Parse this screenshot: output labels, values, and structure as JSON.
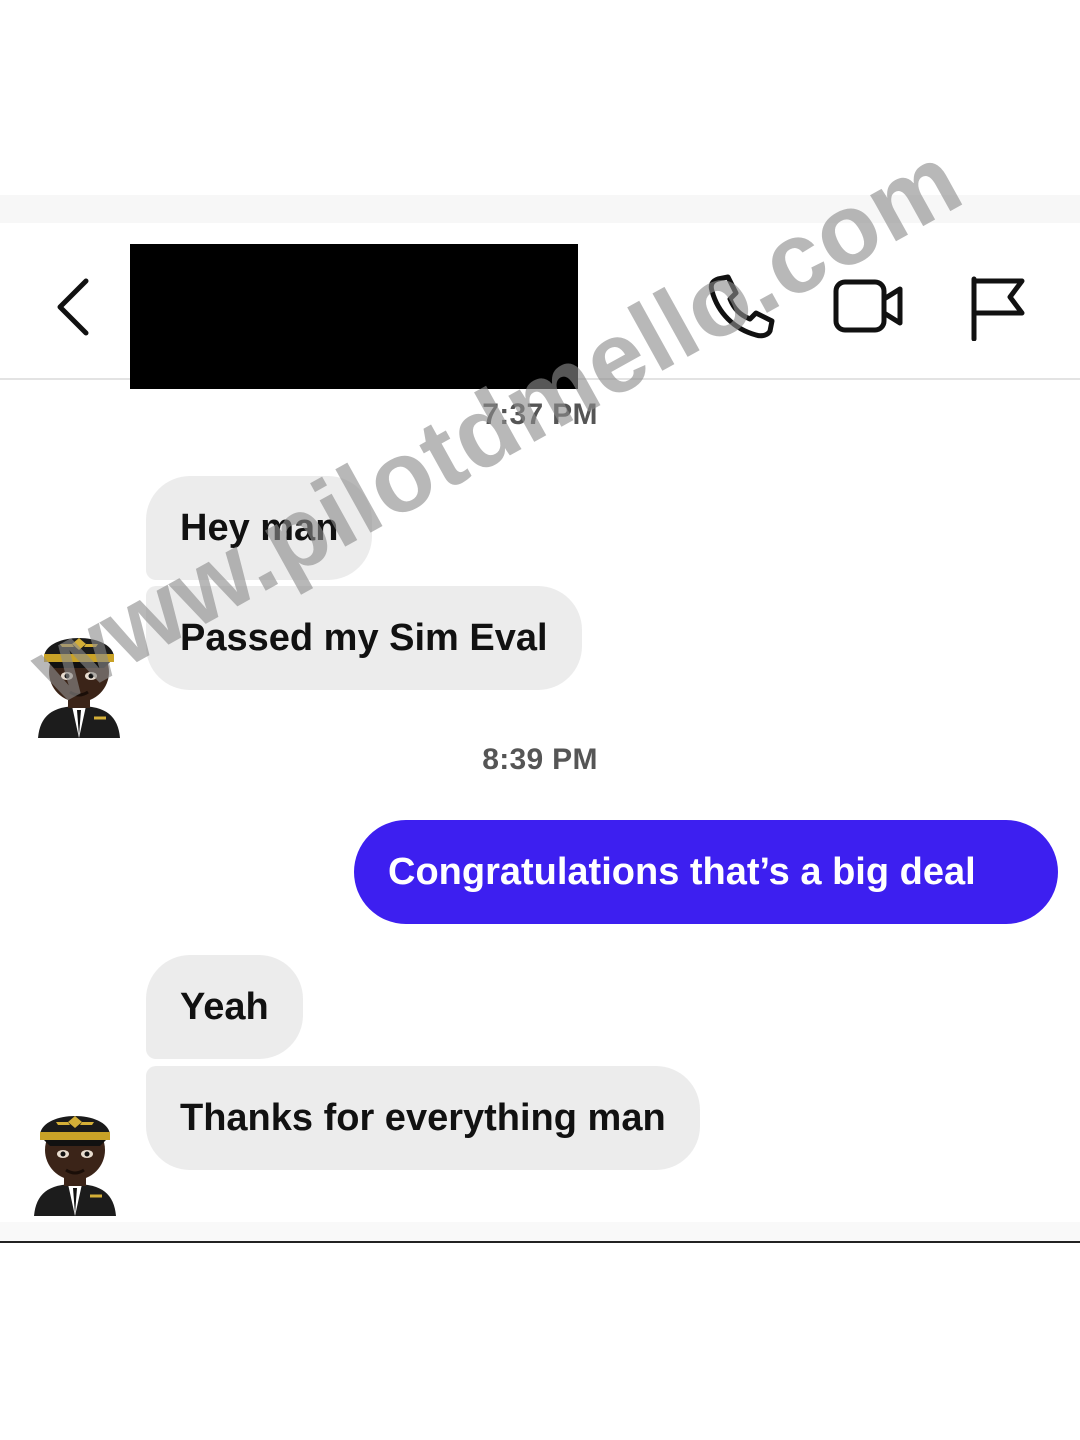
{
  "header": {
    "back_icon": "chevron-left-icon",
    "actions": [
      {
        "icon": "phone-icon"
      },
      {
        "icon": "video-camera-icon"
      },
      {
        "icon": "flag-icon"
      }
    ]
  },
  "messages": {
    "timestamp_1": "7:37 PM",
    "incoming_1": "Hey man",
    "incoming_2": "Passed my Sim Eval",
    "timestamp_2": "8:39 PM",
    "outgoing_1": "Congratulations that’s a big deal",
    "incoming_3": "Yeah",
    "incoming_4": "Thanks for everything man"
  },
  "avatar_icon": "pilot-emoji-icon",
  "watermark": "www.pilotdmello.com",
  "colors": {
    "outgoing_bubble": "#3d1ff0",
    "incoming_bubble": "#ececec",
    "timestamp": "#555555"
  }
}
